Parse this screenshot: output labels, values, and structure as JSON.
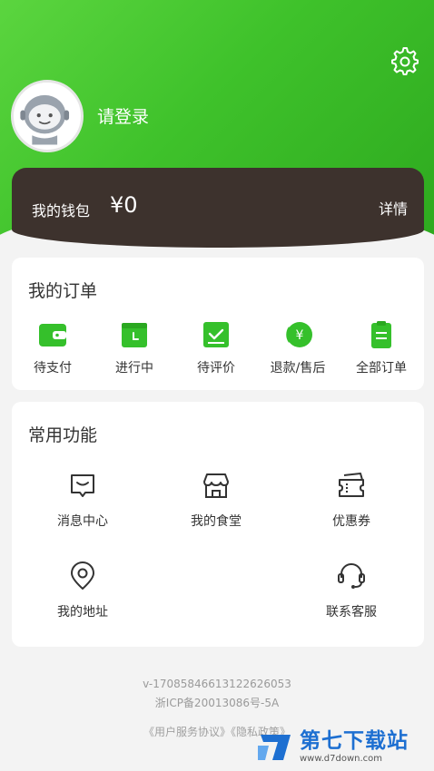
{
  "header": {
    "login_text": "请登录",
    "settings_icon": "gear-icon",
    "avatar_icon": "avatar-icon"
  },
  "wallet": {
    "label": "我的钱包",
    "amount": "¥0",
    "detail_label": "详情"
  },
  "orders": {
    "title": "我的订单",
    "items": [
      {
        "label": "待支付",
        "icon": "wallet-icon"
      },
      {
        "label": "进行中",
        "icon": "calendar-icon"
      },
      {
        "label": "待评价",
        "icon": "checkbox-icon"
      },
      {
        "label": "退款/售后",
        "icon": "refund-icon"
      },
      {
        "label": "全部订单",
        "icon": "clipboard-icon"
      }
    ]
  },
  "functions": {
    "title": "常用功能",
    "items": [
      {
        "label": "消息中心",
        "icon": "message-icon"
      },
      {
        "label": "我的食堂",
        "icon": "canteen-icon"
      },
      {
        "label": "优惠券",
        "icon": "coupon-icon"
      },
      {
        "label": "我的地址",
        "icon": "location-icon"
      },
      {
        "label": "联系客服",
        "icon": "headset-icon"
      }
    ]
  },
  "footer": {
    "version": "v-17085846613122626053",
    "icp": "浙ICP备20013086号-5A",
    "agreements": "《用户服务协议》《隐私政策》"
  },
  "watermark": {
    "name": "第七下载站",
    "url": "www.d7down.com"
  },
  "colors": {
    "brand_green": "#3fc22b",
    "wallet_bg": "#3d322d",
    "icon_green": "#35c02b"
  }
}
